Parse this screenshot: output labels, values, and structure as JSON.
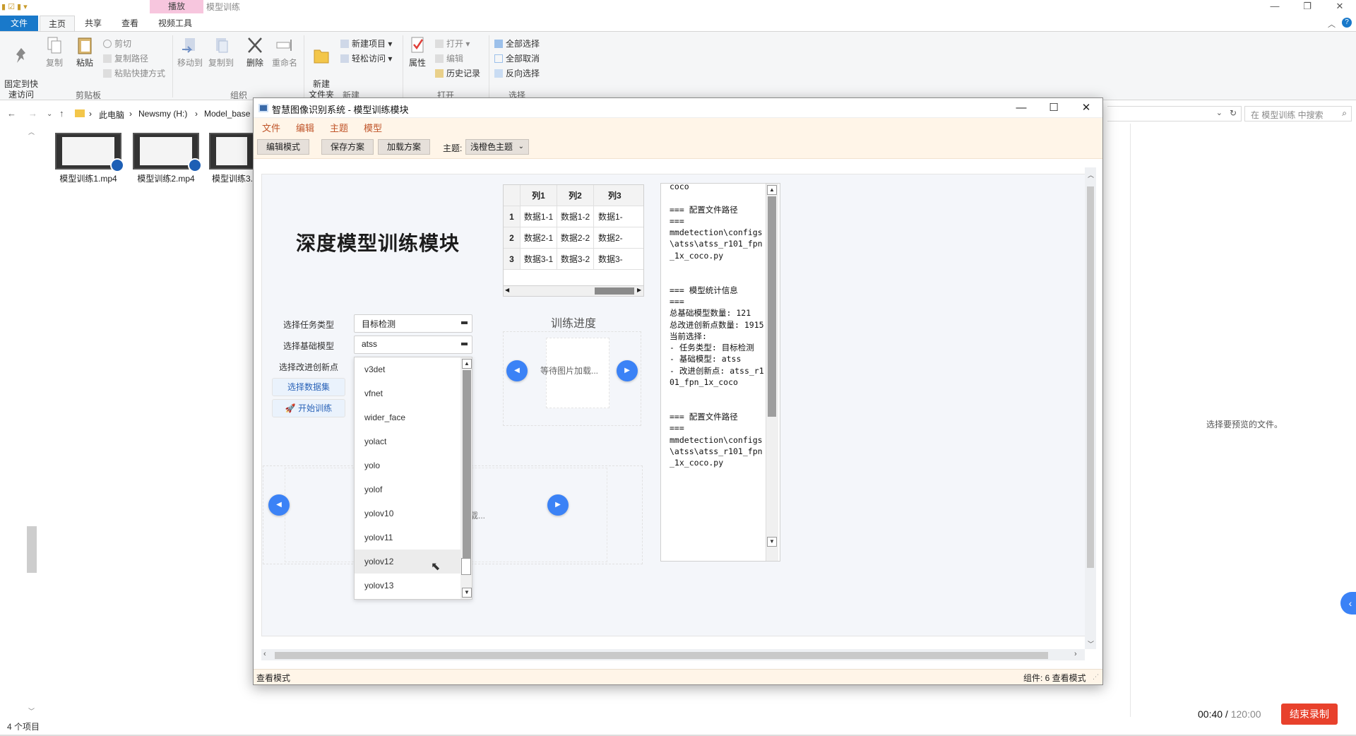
{
  "explorer": {
    "context_tab": "播放",
    "window_title": "模型训练",
    "ribbon_tabs": [
      "文件",
      "主页",
      "共享",
      "查看",
      "视频工具"
    ],
    "ribbon": {
      "pin": "固定到快\n速访问",
      "copy": "复制",
      "paste": "粘贴",
      "cut": "剪切",
      "copy_path": "复制路径",
      "paste_shortcut": "粘贴快捷方式",
      "group_clipboard": "剪贴板",
      "move_to": "移动到",
      "copy_to": "复制到",
      "delete": "删除",
      "rename": "重命名",
      "group_organize": "组织",
      "new_folder": "新建\n文件夹",
      "new_item": "新建项目",
      "easy_access": "轻松访问",
      "group_new": "新建",
      "properties": "属性",
      "open": "打开",
      "edit": "编辑",
      "history": "历史记录",
      "group_open": "打开",
      "select_all": "全部选择",
      "select_none": "全部取消",
      "invert_selection": "反向选择",
      "group_select": "选择"
    },
    "breadcrumb": [
      "此电脑",
      "Newsmy (H:)",
      "Model_base"
    ],
    "search_placeholder": "在 模型训练 中搜索",
    "files": [
      "模型训练1.mp4",
      "模型训练2.mp4",
      "模型训练3."
    ],
    "item_count": "4 个项目",
    "preview_text": "选择要预览的文件。",
    "timer_elapsed": "00:40",
    "timer_sep": " / ",
    "timer_total": "120:00",
    "stop_button": "结束录制"
  },
  "app": {
    "title": "智慧图像识别系统 - 模型训练模块",
    "menus": [
      "文件",
      "编辑",
      "主题",
      "模型"
    ],
    "toolbar": {
      "edit_mode": "编辑模式",
      "save_scheme": "保存方案",
      "load_scheme": "加载方案",
      "theme_label": "主题:",
      "theme_value": "浅橙色主题"
    },
    "main_title": "深度模型训练模块",
    "form": {
      "task_label": "选择任务类型",
      "task_value": "目标检测",
      "model_label": "选择基础模型",
      "model_value": "atss",
      "innovation_label": "选择改进创新点",
      "dataset_button": "选择数据集",
      "train_button": "开始训练"
    },
    "dropdown_items": [
      "v3det",
      "vfnet",
      "wider_face",
      "yolact",
      "yolo",
      "yolof",
      "yolov10",
      "yolov11",
      "yolov12",
      "yolov13"
    ],
    "table": {
      "headers": [
        "",
        "列1",
        "列2",
        "列3"
      ],
      "rows": [
        [
          "1",
          "数据1-1",
          "数据1-2",
          "数据1-"
        ],
        [
          "2",
          "数据2-1",
          "数据2-2",
          "数据2-"
        ],
        [
          "3",
          "数据3-1",
          "数据3-2",
          "数据3-"
        ]
      ]
    },
    "progress_title": "训练进度",
    "waiting_text": "等待图片加载...",
    "lower_waiting_text": "载...",
    "log_text": "coco\n\n=== 配置文件路径\n===\nmmdetection\\configs\\atss\\atss_r101_fpn_1x_coco.py\n\n\n=== 模型统计信息\n===\n总基础模型数量: 121\n总改进创新点数量: 1915\n当前选择:\n- 任务类型: 目标检测\n- 基础模型: atss\n- 改进创新点: atss_r101_fpn_1x_coco\n\n\n=== 配置文件路径\n===\nmmdetection\\configs\\atss\\atss_r101_fpn_1x_coco.py",
    "status_left": "查看模式",
    "status_right": "组件: 6  查看模式"
  },
  "colors": {
    "accent_blue": "#3b82f6",
    "menu_orange": "#c0552a",
    "toolbar_bg": "#fff5e8",
    "stop_red": "#e8412c",
    "file_tab_blue": "#1979ca"
  }
}
